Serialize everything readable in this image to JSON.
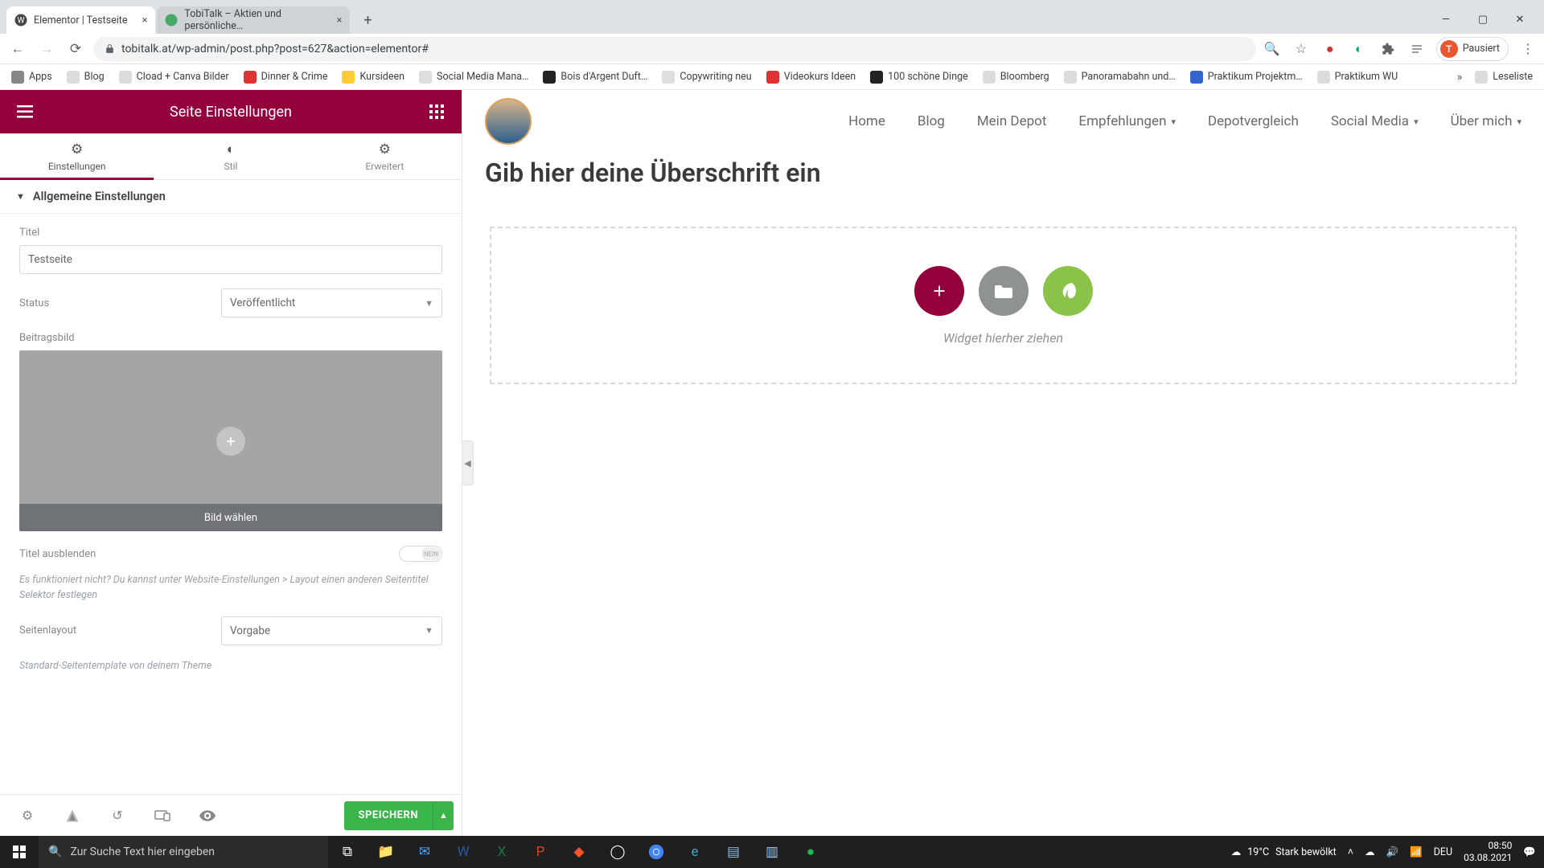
{
  "browser": {
    "tabs": [
      {
        "title": "Elementor | Testseite",
        "favicon": "wp"
      },
      {
        "title": "TobiTalk – Aktien und persönliche…",
        "favicon": "tt"
      }
    ],
    "url": "tobitalk.at/wp-admin/post.php?post=627&action=elementor#",
    "paused_label": "Pausiert",
    "paused_initial": "T",
    "bookmarks": [
      "Apps",
      "Blog",
      "Cload + Canva Bilder",
      "Dinner & Crime",
      "Kursideen",
      "Social Media Mana…",
      "Bois d'Argent Duft…",
      "Copywriting neu",
      "Videokurs Ideen",
      "100 schöne Dinge",
      "Bloomberg",
      "Panoramabahn und…",
      "Praktikum Projektm…",
      "Praktikum WU"
    ],
    "readlist_label": "Leseliste",
    "bookmarks_overflow": "»"
  },
  "sidebar": {
    "title": "Seite Einstellungen",
    "tabs": {
      "settings": "Einstellungen",
      "style": "Stil",
      "advanced": "Erweitert"
    },
    "section": "Allgemeine Einstellungen",
    "fields": {
      "title_label": "Titel",
      "title_value": "Testseite",
      "status_label": "Status",
      "status_value": "Veröffentlicht",
      "image_label": "Beitragsbild",
      "image_caption": "Bild wählen",
      "hide_title_label": "Titel ausblenden",
      "hide_title_toggle": "NEIN",
      "hide_title_help": "Es funktioniert nicht? Du kannst unter Website-Einstellungen > Layout einen anderen Seitentitel Selektor festlegen",
      "layout_label": "Seitenlayout",
      "layout_value": "Vorgabe",
      "layout_help": "Standard-Seitentemplate von deinem Theme"
    },
    "save_label": "SPEICHERN"
  },
  "preview": {
    "nav": [
      "Home",
      "Blog",
      "Mein Depot",
      "Empfehlungen",
      "Depotvergleich",
      "Social Media",
      "Über mich"
    ],
    "nav_dropdown": [
      false,
      false,
      false,
      true,
      false,
      true,
      true
    ],
    "heading_placeholder": "Gib hier deine Überschrift ein",
    "dropzone_hint": "Widget hierher ziehen"
  },
  "taskbar": {
    "search_placeholder": "Zur Suche Text hier eingeben",
    "weather_temp": "19°C",
    "weather_desc": "Stark bewölkt",
    "lang": "DEU",
    "time": "08:50",
    "date": "03.08.2021"
  }
}
